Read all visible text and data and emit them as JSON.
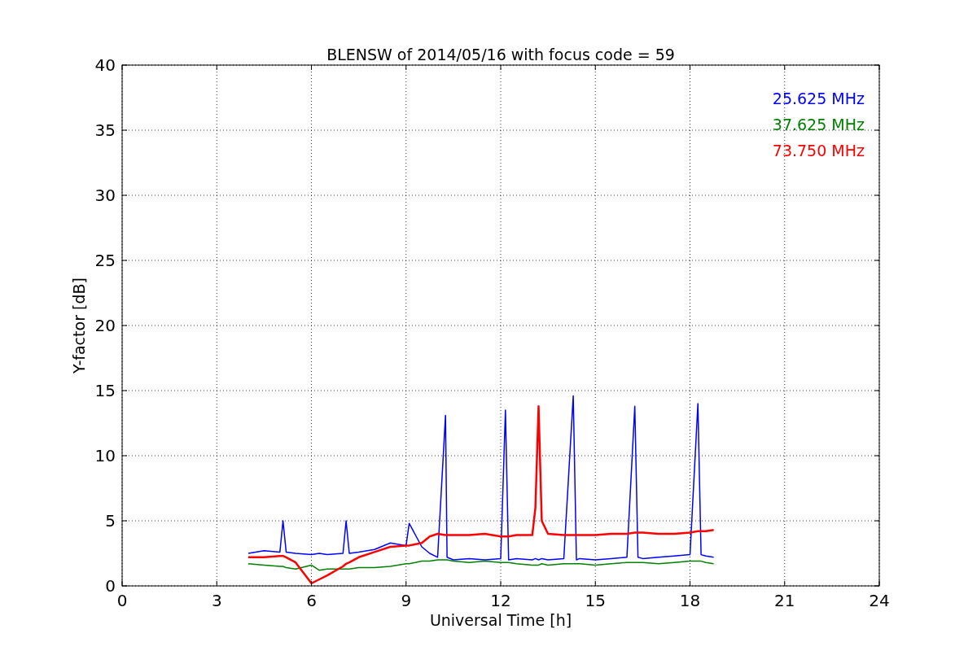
{
  "chart_data": {
    "type": "line",
    "title": "BLENSW of 2014/05/16 with focus code = 59",
    "xlabel": "Universal Time [h]",
    "ylabel": "Y-factor [dB]",
    "x": [
      4.0,
      4.5,
      5.0,
      5.1,
      5.2,
      5.5,
      6.0,
      6.25,
      6.5,
      7.0,
      7.1,
      7.2,
      7.5,
      8.0,
      8.5,
      9.0,
      9.1,
      9.5,
      9.75,
      10.0,
      10.25,
      10.3,
      10.5,
      11.0,
      11.5,
      12.0,
      12.15,
      12.25,
      12.5,
      13.0,
      13.1,
      13.2,
      13.3,
      13.5,
      14.0,
      14.3,
      14.4,
      14.5,
      15.0,
      15.5,
      16.0,
      16.25,
      16.35,
      16.5,
      17.0,
      17.5,
      18.0,
      18.25,
      18.35,
      18.5,
      18.75
    ],
    "series": [
      {
        "name": "25.625 MHz",
        "color": "#0000ff",
        "values": [
          2.5,
          2.7,
          2.6,
          5.0,
          2.6,
          2.5,
          2.4,
          2.5,
          2.4,
          2.5,
          5.0,
          2.5,
          2.6,
          2.8,
          3.3,
          3.1,
          4.8,
          3.0,
          2.5,
          2.2,
          13.1,
          2.2,
          2.0,
          2.1,
          2.0,
          2.1,
          13.5,
          2.0,
          2.1,
          2.0,
          2.1,
          2.0,
          2.1,
          2.0,
          2.1,
          14.6,
          2.0,
          2.1,
          2.0,
          2.1,
          2.2,
          13.8,
          2.2,
          2.1,
          2.2,
          2.3,
          2.4,
          14.0,
          2.4,
          2.3,
          2.2
        ]
      },
      {
        "name": "37.625 MHz",
        "color": "#008000",
        "values": [
          1.7,
          1.6,
          1.5,
          1.5,
          1.4,
          1.3,
          1.6,
          1.2,
          1.3,
          1.3,
          1.3,
          1.3,
          1.4,
          1.4,
          1.5,
          1.7,
          1.7,
          1.9,
          1.9,
          2.0,
          2.0,
          2.0,
          1.9,
          1.8,
          1.9,
          1.8,
          1.8,
          1.8,
          1.7,
          1.6,
          1.6,
          1.6,
          1.7,
          1.6,
          1.7,
          1.7,
          1.7,
          1.7,
          1.6,
          1.7,
          1.8,
          1.8,
          1.8,
          1.8,
          1.7,
          1.8,
          1.9,
          1.9,
          1.9,
          1.8,
          1.7
        ]
      },
      {
        "name": "73.750 MHz",
        "color": "#ff0000",
        "values": [
          2.2,
          2.2,
          2.3,
          2.3,
          2.2,
          1.8,
          0.2,
          0.5,
          0.8,
          1.5,
          1.7,
          1.8,
          2.2,
          2.6,
          3.0,
          3.1,
          3.1,
          3.3,
          3.8,
          4.0,
          3.9,
          3.9,
          3.9,
          3.9,
          4.0,
          3.8,
          3.8,
          3.8,
          3.9,
          3.9,
          6.0,
          13.8,
          5.0,
          4.0,
          3.9,
          3.9,
          3.9,
          3.9,
          3.9,
          4.0,
          4.0,
          4.1,
          4.1,
          4.1,
          4.0,
          4.0,
          4.1,
          4.2,
          4.2,
          4.2,
          4.3
        ]
      }
    ],
    "xlim": [
      0,
      24
    ],
    "ylim": [
      0,
      40
    ],
    "xticks": [
      0,
      3,
      6,
      9,
      12,
      15,
      18,
      21,
      24
    ],
    "yticks": [
      0,
      5,
      10,
      15,
      20,
      25,
      30,
      35,
      40
    ],
    "grid": true
  }
}
